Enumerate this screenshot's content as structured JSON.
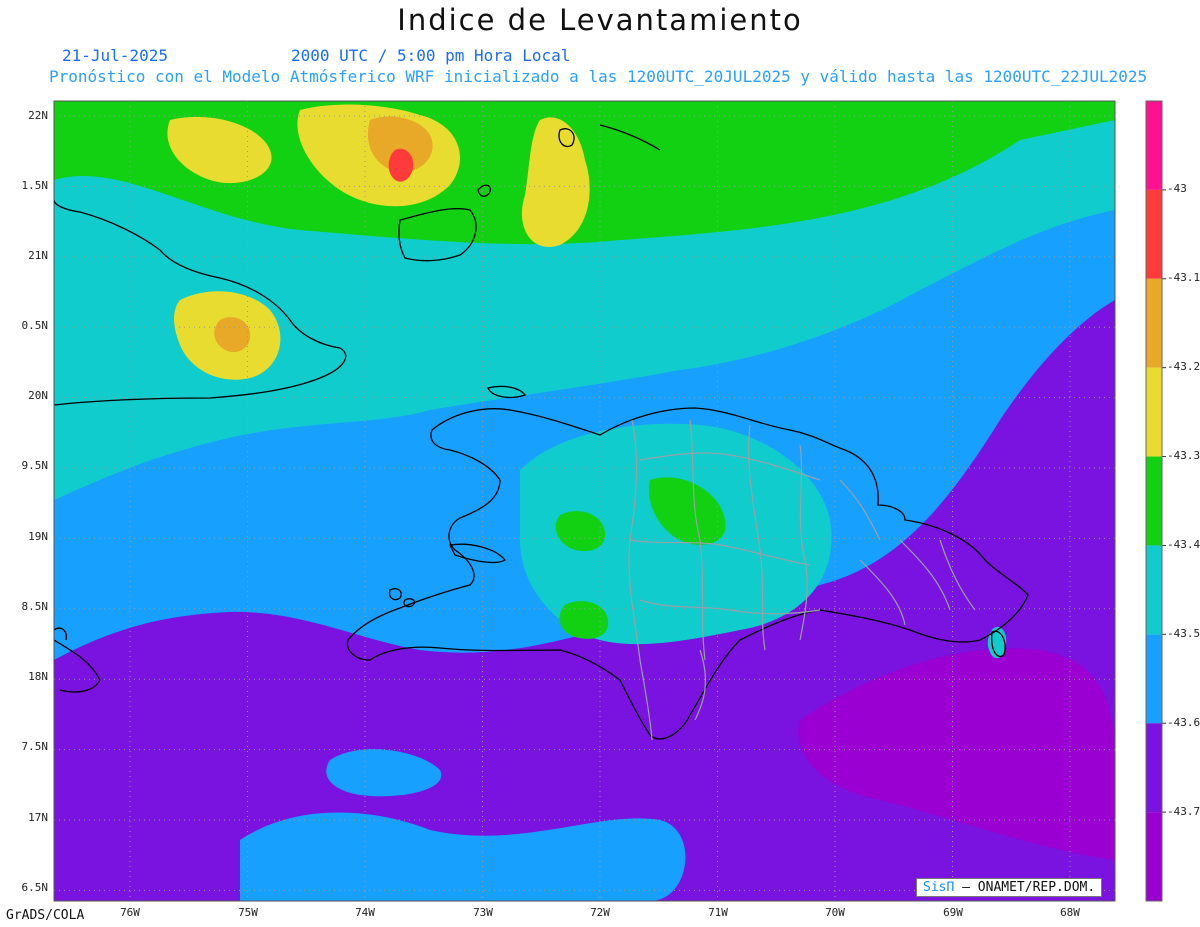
{
  "header": {
    "title": "Indice de Levantamiento",
    "date": "21-Jul-2025",
    "time": "2000 UTC / 5:00 pm Hora Local",
    "forecast": "Pronóstico con el Modelo Atmósferico WRF inicializado a las 1200UTC_20JUL2025 y válido hasta las  1200UTC_22JUL2025"
  },
  "axes": {
    "lat_labels": [
      "22N",
      "1.5N",
      "21N",
      "0.5N",
      "20N",
      "9.5N",
      "19N",
      "8.5N",
      "18N",
      "7.5N",
      "17N",
      "6.5N"
    ],
    "lon_labels": [
      "76W",
      "75W",
      "74W",
      "73W",
      "72W",
      "71W",
      "70W",
      "69W",
      "68W"
    ]
  },
  "colorbar": {
    "labels": [
      "-43",
      "-43.1",
      "-43.2",
      "-43.3",
      "-43.4",
      "-43.5",
      "-43.6",
      "-43.7"
    ],
    "colors": [
      "#ff1090",
      "#ff3a3a",
      "#e8a828",
      "#e8dc30",
      "#12d012",
      "#10cccc",
      "#18a0ff",
      "#7a12e0",
      "#9b00d2"
    ]
  },
  "footer": {
    "software": "GrADS/COLA",
    "credit_brand": "SisΠ",
    "credit_org": "– ONAMET/REP.DOM."
  }
}
